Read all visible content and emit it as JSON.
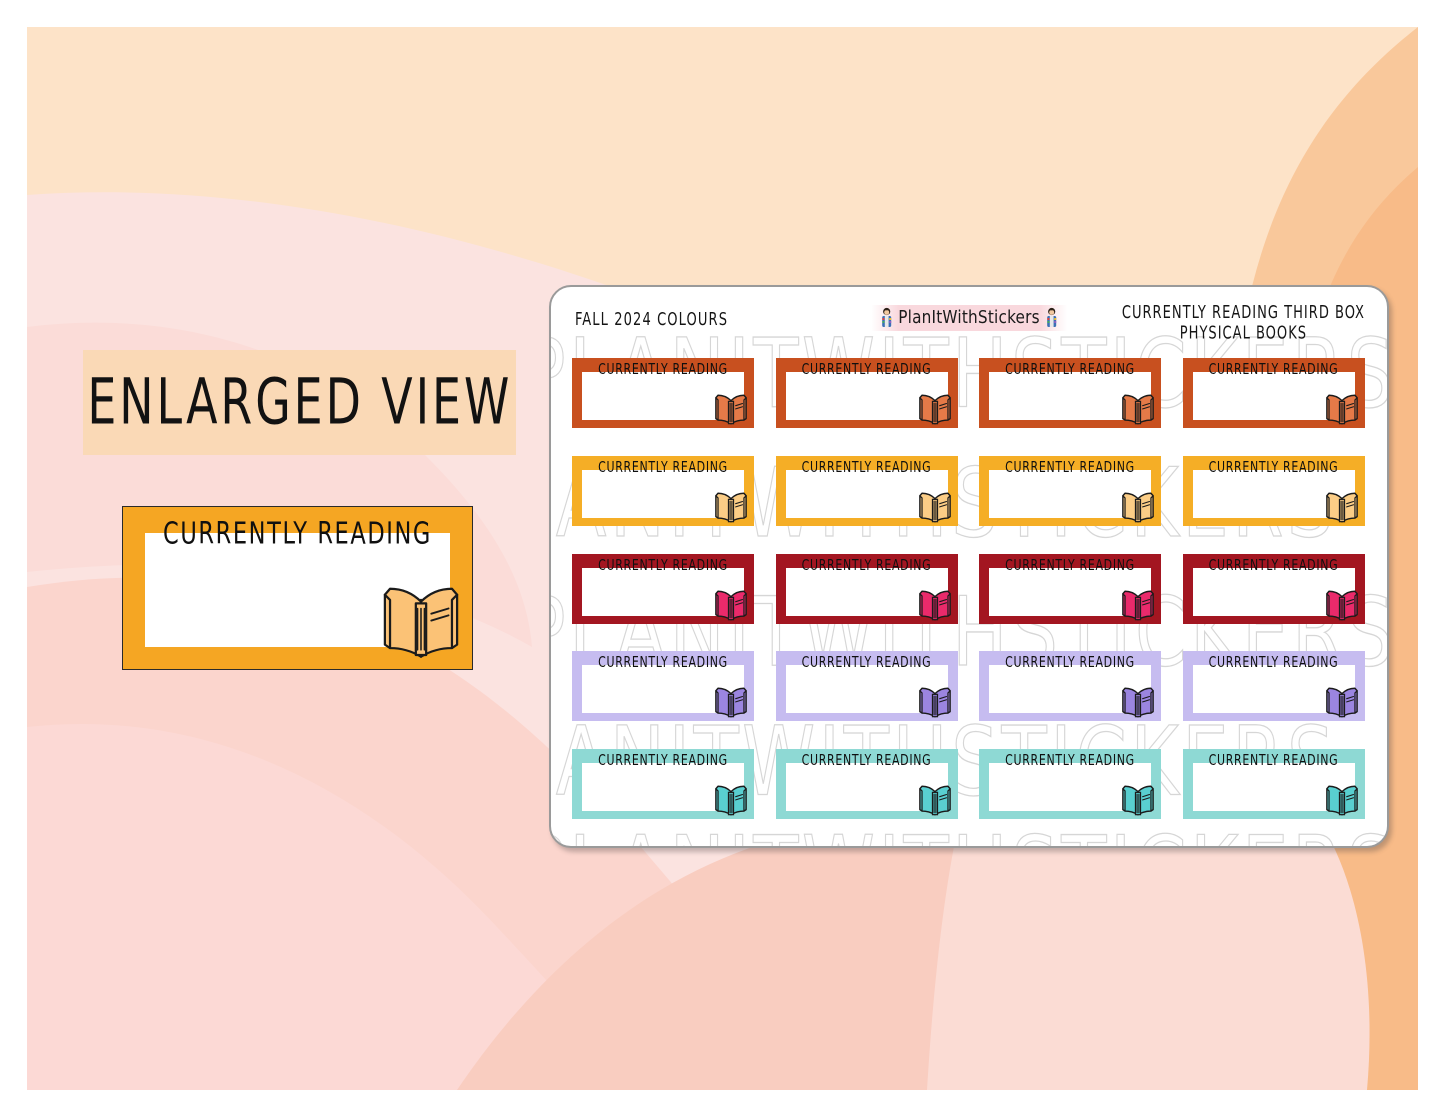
{
  "page": {
    "background_colors": [
      "#fde3c8",
      "#fbe3e0",
      "#f9d6cf",
      "#fbd2c6",
      "#f7c9a0",
      "#f9b57d"
    ]
  },
  "enlarged_view": {
    "heading": "ENLARGED VIEW",
    "heading_bg": "#fad9b6",
    "sample": {
      "label": "CURRENTLY READING",
      "frame_color": "#f5a623",
      "book_color": "#fbc276",
      "icon": "open-book-icon"
    }
  },
  "sheet": {
    "header": {
      "left": "FALL 2024 COLOURS",
      "brand": "PlanItWithStickers",
      "brand_icon_left": "person-avatar-icon",
      "brand_icon_right": "person-avatar-icon",
      "right_line1": "CURRENTLY READING THIRD BOX",
      "right_line2": "PHYSICAL BOOKS"
    },
    "watermark_text": "PLANITWITHSTICKERS",
    "sticker_label": "CURRENTLY READING",
    "columns": 4,
    "rows": [
      {
        "name": "rust",
        "frame_color": "#c8501f",
        "book_color": "#e57a48"
      },
      {
        "name": "amber",
        "frame_color": "#f5ae26",
        "book_color": "#fbcd86"
      },
      {
        "name": "maroon",
        "frame_color": "#a31621",
        "book_color": "#ea2a6b"
      },
      {
        "name": "lavender",
        "frame_color": "#c6bcf0",
        "book_color": "#9b85e0"
      },
      {
        "name": "teal",
        "frame_color": "#8ed9d4",
        "book_color": "#59cfd0"
      }
    ]
  }
}
